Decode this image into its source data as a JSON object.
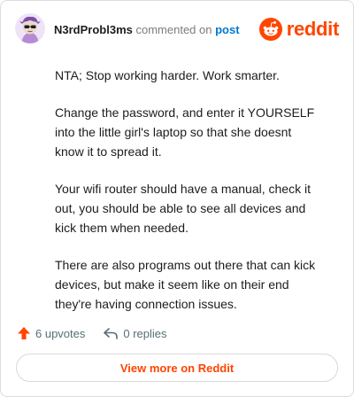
{
  "header": {
    "username": "N3rdProbl3ms",
    "action": " commented on ",
    "post_link": "post",
    "brand": "reddit"
  },
  "comment": {
    "paragraphs": [
      "NTA; Stop working harder. Work smarter.",
      "Change the password, and enter it YOURSELF into the little girl's laptop so that she doesnt know it to spread it.",
      "Your wifi router should have a manual, check it out, you should be able to see all devices and kick them when needed.",
      "There are also programs out there that can kick devices, but make it seem like on their end they're having connection issues."
    ]
  },
  "footer": {
    "upvotes": "6 upvotes",
    "replies": "0 replies"
  },
  "view_more": "View more on Reddit",
  "colors": {
    "brand": "#ff4500",
    "link": "#0079d3",
    "muted": "#576f76"
  }
}
